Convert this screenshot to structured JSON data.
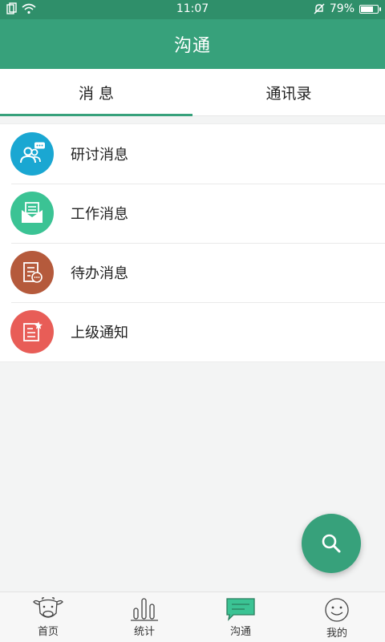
{
  "status_bar": {
    "time": "11:07",
    "battery": "79%",
    "battery_level": 0.79
  },
  "header": {
    "title": "沟通"
  },
  "tabs": [
    {
      "label": "消 息",
      "active": true
    },
    {
      "label": "通讯录",
      "active": false
    }
  ],
  "message_list": [
    {
      "label": "研讨消息",
      "icon": "discussion-icon",
      "color": "#1aa7d2"
    },
    {
      "label": "工作消息",
      "icon": "mail-icon",
      "color": "#3bc394"
    },
    {
      "label": "待办消息",
      "icon": "todo-icon",
      "color": "#b55a3c"
    },
    {
      "label": "上级通知",
      "icon": "notice-icon",
      "color": "#e85d57"
    }
  ],
  "fab": {
    "icon": "search-icon",
    "color": "#37a17b"
  },
  "bottom_nav": [
    {
      "label": "首页",
      "icon": "cow-icon"
    },
    {
      "label": "统计",
      "icon": "bar-chart-icon"
    },
    {
      "label": "沟通",
      "icon": "chat-icon",
      "active": true
    },
    {
      "label": "我的",
      "icon": "smiley-icon"
    }
  ],
  "colors": {
    "primary": "#37a17b",
    "status_bar": "#2f8f6a"
  }
}
